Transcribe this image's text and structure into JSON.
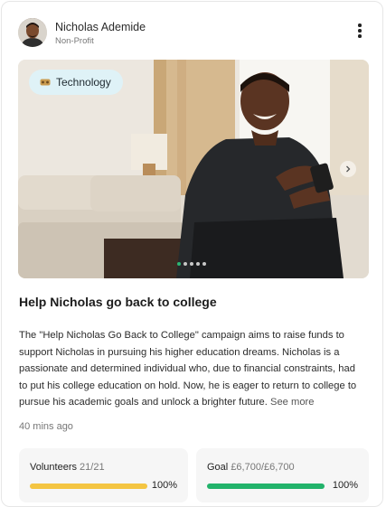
{
  "user": {
    "name": "Nicholas Ademide",
    "role": "Non-Profit"
  },
  "media": {
    "tag": "Technology",
    "slides_total": 5,
    "active_slide": 1
  },
  "campaign": {
    "title": "Help Nicholas go back to college",
    "description": "The \"Help Nicholas Go Back to College\" campaign aims to raise funds to support Nicholas in pursuing his higher education dreams. Nicholas is a passionate and determined individual who, due to financial constraints, had to put his college education on hold. Now, he is eager to return to college to pursue his academic goals and unlock a brighter future.",
    "see_more": "See more",
    "posted": "40 mins ago"
  },
  "stats": {
    "volunteers": {
      "label": "Volunteers",
      "value": "21/21",
      "percent_text": "100%",
      "progress": 1.0
    },
    "goal": {
      "label": "Goal",
      "value": "£6,700/£6,700",
      "percent_text": "100%",
      "progress": 1.0
    }
  },
  "colors": {
    "volunteers_bar": "#f4c542",
    "goal_bar": "#22b36b",
    "tag_bg": "#dff2f7",
    "active_dot": "#2bb673"
  }
}
